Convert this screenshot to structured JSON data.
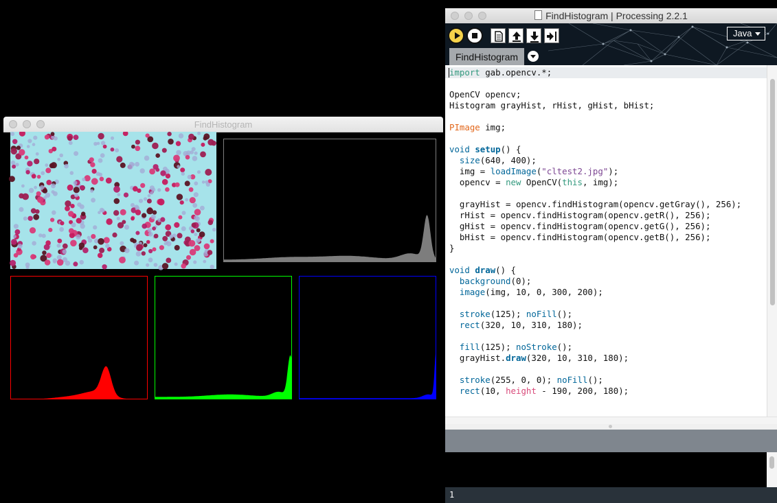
{
  "sketch_window": {
    "title": "FindHistogram",
    "rgb_image_colors": {
      "background": "#a6e3ea",
      "cells": [
        "#c51a5e",
        "#b4226c",
        "#9d1d52",
        "#5a1424",
        "#d83a79",
        "#a4abd6"
      ]
    },
    "histogram_panels": [
      {
        "name": "gray",
        "stroke": "#7d7d7d",
        "fill": "#7d7d7d"
      },
      {
        "name": "red",
        "stroke": "#ff0000",
        "fill": "#ff0000"
      },
      {
        "name": "green",
        "stroke": "#00ff00",
        "fill": "#00ff00"
      },
      {
        "name": "blue",
        "stroke": "#0000ff",
        "fill": "#0000ff"
      }
    ]
  },
  "ide": {
    "title": "FindHistogram | Processing 2.2.1",
    "toolbar": {
      "run_icon": "play-icon",
      "stop_icon": "stop-icon",
      "new_icon": "new-document-icon",
      "open_icon": "arrow-up-icon",
      "save_icon": "arrow-down-icon",
      "export_icon": "export-arrow-icon",
      "mode": "Java"
    },
    "tab": "FindHistogram",
    "code_lines": [
      "import gab.opencv.*;",
      "",
      "OpenCV opencv;",
      "Histogram grayHist, rHist, gHist, bHist;",
      "",
      "PImage img;",
      "",
      "void setup() {",
      "  size(640, 400);",
      "  img = loadImage(\"cltest2.jpg\");",
      "  opencv = new OpenCV(this, img);",
      "",
      "  grayHist = opencv.findHistogram(opencv.getGray(), 256);",
      "  rHist = opencv.findHistogram(opencv.getR(), 256);",
      "  gHist = opencv.findHistogram(opencv.getG(), 256);",
      "  bHist = opencv.findHistogram(opencv.getB(), 256);",
      "}",
      "",
      "void draw() {",
      "  background(0);",
      "  image(img, 10, 0, 300, 200);",
      "",
      "  stroke(125); noFill();",
      "  rect(320, 10, 310, 180);",
      "",
      "  fill(125); noStroke();",
      "  grayHist.draw(320, 10, 310, 180);",
      "",
      "  stroke(255, 0, 0); noFill();",
      "  rect(10, height - 190, 200, 180);"
    ],
    "status_line": "1"
  }
}
